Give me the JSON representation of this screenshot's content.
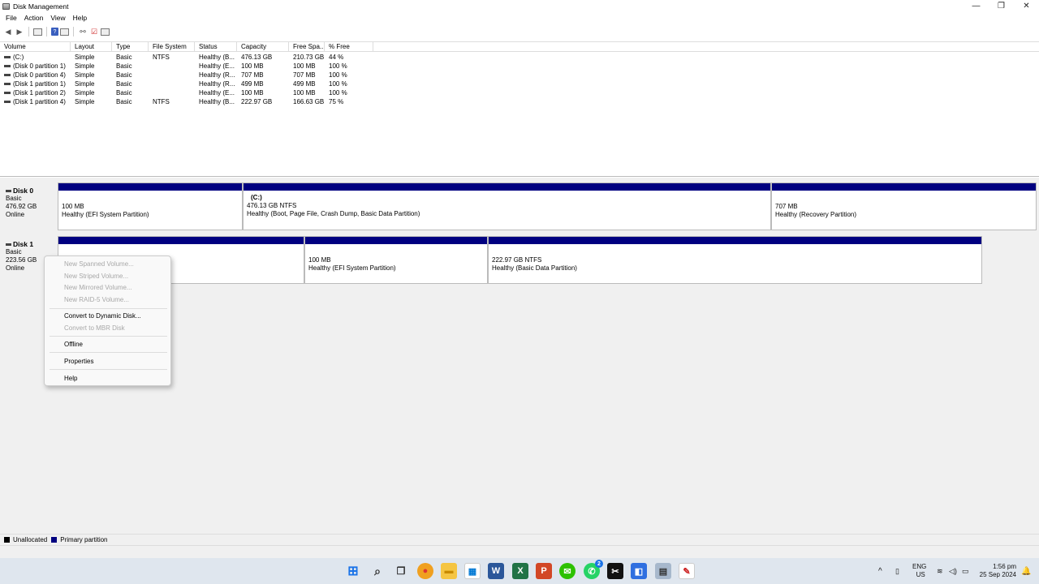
{
  "window": {
    "title": "Disk Management",
    "controls": [
      "—",
      "❐",
      "✕"
    ]
  },
  "menu": [
    "File",
    "Action",
    "View",
    "Help"
  ],
  "columns": [
    "Volume",
    "Layout",
    "Type",
    "File System",
    "Status",
    "Capacity",
    "Free Spa...",
    "% Free"
  ],
  "volumes": [
    [
      "(C:)",
      "Simple",
      "Basic",
      "NTFS",
      "Healthy (B...",
      "476.13 GB",
      "210.73 GB",
      "44 %"
    ],
    [
      "(Disk 0 partition 1)",
      "Simple",
      "Basic",
      "",
      "Healthy (E...",
      "100 MB",
      "100 MB",
      "100 %"
    ],
    [
      "(Disk 0 partition 4)",
      "Simple",
      "Basic",
      "",
      "Healthy (R...",
      "707 MB",
      "707 MB",
      "100 %"
    ],
    [
      "(Disk 1 partition 1)",
      "Simple",
      "Basic",
      "",
      "Healthy (R...",
      "499 MB",
      "499 MB",
      "100 %"
    ],
    [
      "(Disk 1 partition 2)",
      "Simple",
      "Basic",
      "",
      "Healthy (E...",
      "100 MB",
      "100 MB",
      "100 %"
    ],
    [
      "(Disk 1 partition 4)",
      "Simple",
      "Basic",
      "NTFS",
      "Healthy (B...",
      "222.97 GB",
      "166.63 GB",
      "75 %"
    ]
  ],
  "disks": [
    {
      "name": "Disk 0",
      "type": "Basic",
      "size": "476.92 GB",
      "status": "Online",
      "partitions": [
        {
          "title": "",
          "size": "100 MB",
          "status": "Healthy (EFI System Partition)"
        },
        {
          "title": "(C:)",
          "size": "476.13 GB NTFS",
          "status": "Healthy (Boot, Page File, Crash Dump, Basic Data Partition)"
        },
        {
          "title": "",
          "size": "707 MB",
          "status": "Healthy (Recovery Partition)"
        }
      ]
    },
    {
      "name": "Disk 1",
      "type": "Basic",
      "size": "223.56 GB",
      "status": "Online",
      "partitions": [
        {
          "title": "",
          "size": "",
          "status": ""
        },
        {
          "title": "",
          "size": "100 MB",
          "status": "Healthy (EFI System Partition)"
        },
        {
          "title": "",
          "size": "222.97 GB NTFS",
          "status": "Healthy (Basic Data Partition)"
        }
      ]
    }
  ],
  "legend": {
    "unallocated": "Unallocated",
    "primary": "Primary partition",
    "unallocated_color": "#000000",
    "primary_color": "#000080"
  },
  "context_menu": {
    "new_spanned": "New Spanned Volume...",
    "new_striped": "New Striped Volume...",
    "new_mirrored": "New Mirrored Volume...",
    "new_raid5": "New RAID-5 Volume...",
    "convert_dynamic": "Convert to Dynamic Disk...",
    "convert_mbr": "Convert to MBR Disk",
    "offline": "Offline",
    "properties": "Properties",
    "help": "Help"
  },
  "taskbar": {
    "apps": [
      "windows-start-icon",
      "search-icon",
      "task-view-icon",
      "chrome-icon",
      "file-explorer-icon",
      "store-icon",
      "word-icon",
      "excel-icon",
      "powerpoint-icon",
      "wechat-icon",
      "whatsapp-icon",
      "capcut-icon",
      "app-icon",
      "disk-management-icon",
      "notepad-icon"
    ],
    "whatsapp_badge": "2",
    "lang_line1": "ENG",
    "lang_line2": "US",
    "time": "1:56 pm",
    "date": "25 Sep 2024"
  }
}
